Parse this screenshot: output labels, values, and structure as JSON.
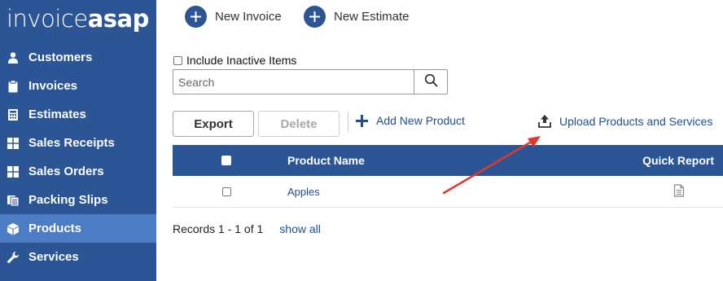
{
  "app": {
    "logo_light": "invoice",
    "logo_bold": "asap"
  },
  "sidebar": {
    "items": [
      {
        "label": "Customers",
        "icon": "user-icon"
      },
      {
        "label": "Invoices",
        "icon": "clipboard-icon"
      },
      {
        "label": "Estimates",
        "icon": "calculator-icon"
      },
      {
        "label": "Sales Receipts",
        "icon": "grid-icon"
      },
      {
        "label": "Sales Orders",
        "icon": "grid-icon"
      },
      {
        "label": "Packing Slips",
        "icon": "packing-icon"
      },
      {
        "label": "Products",
        "icon": "cube-icon",
        "active": true
      },
      {
        "label": "Services",
        "icon": "wrench-icon"
      }
    ]
  },
  "toolbar": {
    "new_invoice": "New Invoice",
    "new_estimate": "New Estimate"
  },
  "filters": {
    "include_inactive_label": "Include Inactive Items",
    "include_inactive_checked": false,
    "search_placeholder": "Search",
    "search_value": ""
  },
  "actions": {
    "export": "Export",
    "delete": "Delete",
    "add_new_product": "Add New Product",
    "upload": "Upload Products and Services"
  },
  "table": {
    "headers": {
      "product_name": "Product Name",
      "quick_report": "Quick Report"
    },
    "rows": [
      {
        "product_name": "Apples"
      }
    ]
  },
  "pagination": {
    "records_text": "Records 1 - 1 of 1",
    "show_all": "show all"
  },
  "colors": {
    "brand_blue": "#2b5594",
    "active_nav": "#4d7cc4",
    "link_blue": "#1f4e8e",
    "annotation_arrow": "#e0392b"
  }
}
